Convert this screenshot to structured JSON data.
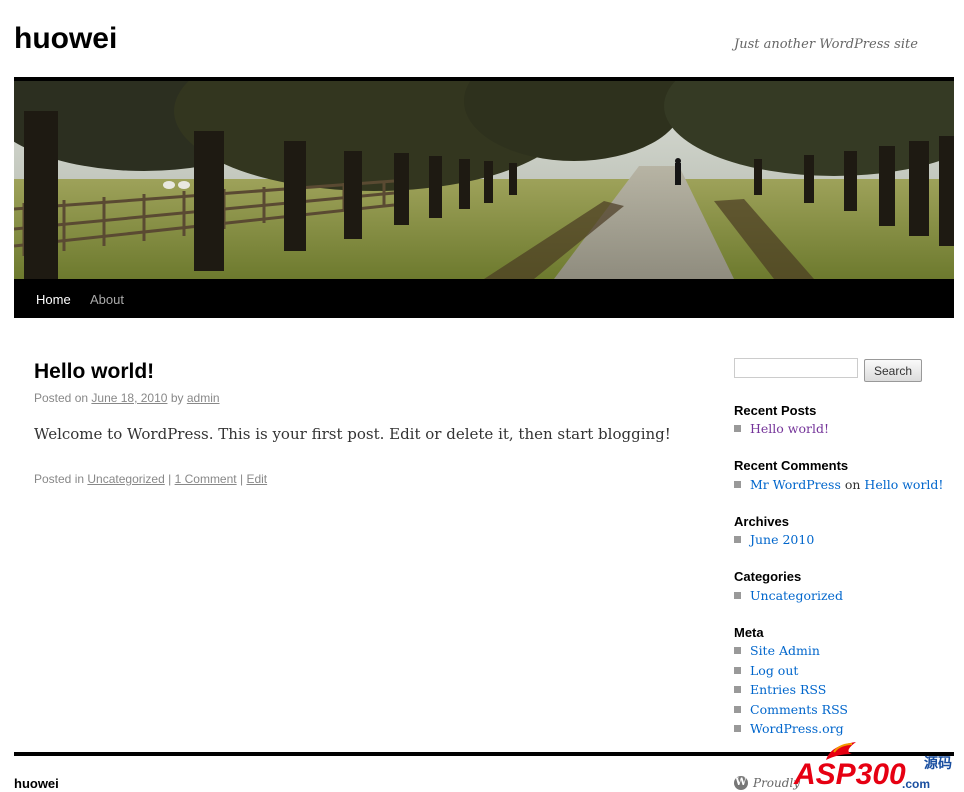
{
  "site": {
    "title": "huowei",
    "description": "Just another WordPress site"
  },
  "nav": {
    "items": [
      {
        "label": "Home"
      },
      {
        "label": "About"
      }
    ]
  },
  "post": {
    "title": "Hello world!",
    "meta_prefix": "Posted on",
    "date": "June 18, 2010",
    "by": "by",
    "author": "admin",
    "content": "Welcome to WordPress. This is your first post. Edit or delete it, then start blogging!",
    "posted_in": "Posted in",
    "category": "Uncategorized",
    "sep": "|",
    "comments": "1 Comment",
    "edit": "Edit"
  },
  "sidebar": {
    "search_button": "Search",
    "recent_posts": {
      "title": "Recent Posts",
      "items": [
        "Hello world!"
      ]
    },
    "recent_comments": {
      "title": "Recent Comments",
      "commenter": "Mr WordPress",
      "on": "on",
      "post": "Hello world!"
    },
    "archives": {
      "title": "Archives",
      "items": [
        "June 2010"
      ]
    },
    "categories": {
      "title": "Categories",
      "items": [
        "Uncategorized"
      ]
    },
    "meta": {
      "title": "Meta",
      "items": [
        "Site Admin",
        "Log out",
        "Entries RSS",
        "Comments RSS",
        "WordPress.org"
      ]
    }
  },
  "footer": {
    "site_title": "huowei",
    "powered_text": "Proudly"
  },
  "watermark": {
    "brand": "ASP300",
    "domain": ".com",
    "side_text": "源码"
  },
  "colors": {
    "link": "#0066cc",
    "visited_link": "#743399",
    "bar": "#000000",
    "watermark_red": "#e60012",
    "watermark_blue": "#1a4fa0"
  }
}
